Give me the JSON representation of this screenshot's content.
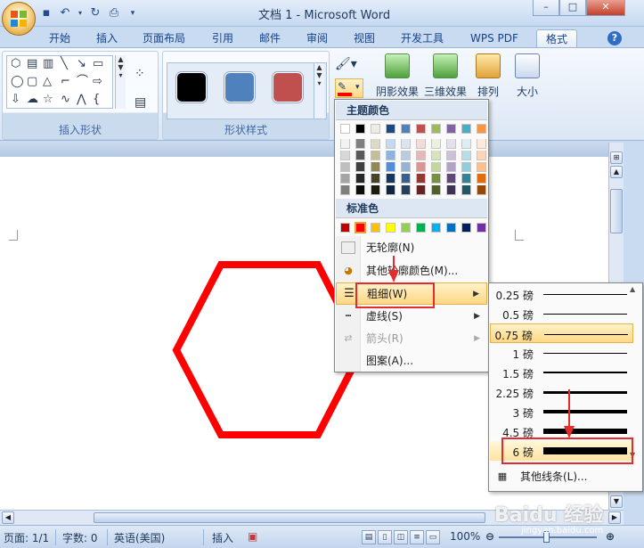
{
  "window": {
    "title": "文档 1 - Microsoft Word",
    "controls": {
      "minimize": "–",
      "maximize": "□",
      "close": "✕"
    }
  },
  "ribbon": {
    "tabs": [
      {
        "label": "开始"
      },
      {
        "label": "插入"
      },
      {
        "label": "页面布局"
      },
      {
        "label": "引用"
      },
      {
        "label": "邮件"
      },
      {
        "label": "审阅"
      },
      {
        "label": "视图"
      },
      {
        "label": "开发工具"
      },
      {
        "label": "WPS PDF"
      },
      {
        "label": "格式"
      }
    ],
    "active_tab": "格式",
    "groups": {
      "insert_shapes": "插入形状",
      "shape_styles": "形状样式",
      "size": "大小"
    },
    "buttons": {
      "shadow_effect": "阴影效果",
      "three_d_effect": "三维效果",
      "arrange": "排列",
      "size": "大小"
    },
    "style_swatches": [
      "#000000",
      "#4f81bd",
      "#c0504d"
    ]
  },
  "outline_menu": {
    "theme_colors_title": "主题颜色",
    "standard_colors_title": "标准色",
    "theme_top_row": [
      "#ffffff",
      "#000000",
      "#eeece1",
      "#1f497d",
      "#4f81bd",
      "#c0504d",
      "#9bbb59",
      "#8064a2",
      "#4bacc6",
      "#f79646"
    ],
    "theme_columns": [
      [
        "#f2f2f2",
        "#d8d8d8",
        "#bfbfbf",
        "#a5a5a5",
        "#7f7f7f"
      ],
      [
        "#7f7f7f",
        "#595959",
        "#3f3f3f",
        "#262626",
        "#0c0c0c"
      ],
      [
        "#ddd9c3",
        "#c4bd97",
        "#938953",
        "#494429",
        "#1d1b10"
      ],
      [
        "#c6d9f0",
        "#8db3e2",
        "#548dd4",
        "#17365d",
        "#0f243e"
      ],
      [
        "#dbe5f1",
        "#b8cce4",
        "#95b3d7",
        "#366092",
        "#244061"
      ],
      [
        "#f2dcdb",
        "#e5b9b7",
        "#d99694",
        "#953734",
        "#632423"
      ],
      [
        "#ebf1dd",
        "#d7e3bc",
        "#c3d69b",
        "#76923c",
        "#4f6128"
      ],
      [
        "#e5e0ec",
        "#ccc1d9",
        "#b2a2c7",
        "#5f497a",
        "#3f3151"
      ],
      [
        "#dbeef3",
        "#b7dde8",
        "#92cddc",
        "#31859b",
        "#205867"
      ],
      [
        "#fdeada",
        "#fbd5b5",
        "#fac08f",
        "#e36c09",
        "#974806"
      ]
    ],
    "standard_colors": [
      "#c00000",
      "#ff0000",
      "#ffc000",
      "#ffff00",
      "#92d050",
      "#00b050",
      "#00b0f0",
      "#0070c0",
      "#002060",
      "#7030a0"
    ],
    "items": [
      {
        "label": "无轮廓(N)",
        "disabled": false
      },
      {
        "label": "其他轮廓颜色(M)...",
        "disabled": false
      },
      {
        "label": "粗细(W)",
        "disabled": false,
        "highlight": true
      },
      {
        "label": "虚线(S)",
        "disabled": false
      },
      {
        "label": "箭头(R)",
        "disabled": true
      },
      {
        "label": "图案(A)...",
        "disabled": false
      }
    ]
  },
  "weight_menu": {
    "items": [
      {
        "label": "0.25 磅",
        "weight": 0.25
      },
      {
        "label": "0.5 磅",
        "weight": 0.5
      },
      {
        "label": "0.75 磅",
        "weight": 0.75,
        "selected": true
      },
      {
        "label": "1 磅",
        "weight": 1
      },
      {
        "label": "1.5 磅",
        "weight": 1.5
      },
      {
        "label": "2.25 磅",
        "weight": 2.25
      },
      {
        "label": "3 磅",
        "weight": 3
      },
      {
        "label": "4.5 磅",
        "weight": 4.5
      },
      {
        "label": "6 磅",
        "weight": 6,
        "boxed": true
      }
    ],
    "more_lines": "其他线条(L)..."
  },
  "document": {
    "hexagon_color": "#ff0000"
  },
  "statusbar": {
    "page": "页面: 1/1",
    "words": "字数: 0",
    "language": "英语(美国)",
    "mode": "插入",
    "zoom": "100%"
  },
  "watermark": {
    "brand": "Baidu 经验",
    "url": "jingyan.baidu.com"
  }
}
